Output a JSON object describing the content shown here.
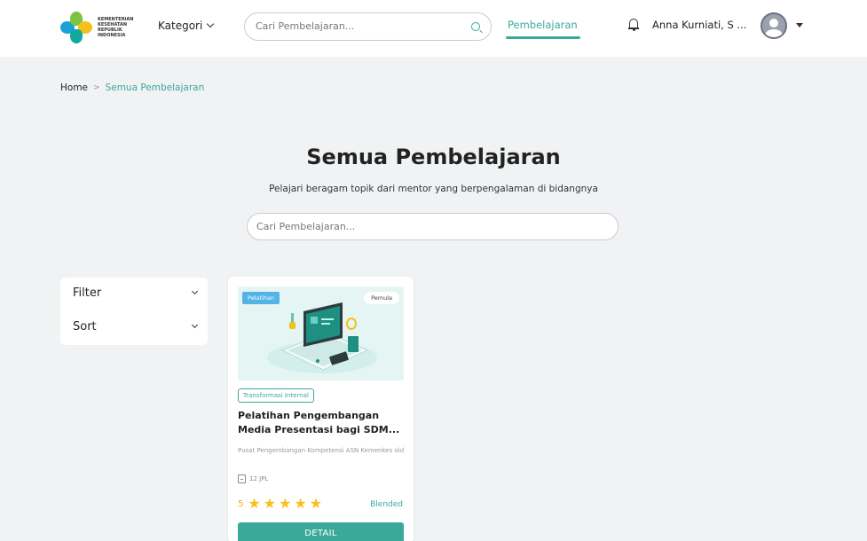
{
  "header": {
    "logo_text": "KEMENTERIAN KESEHATAN REPUBLIK INDONESIA",
    "kategori_label": "Kategori",
    "search_placeholder": "Cari Pembelajaran...",
    "nav_active": "Pembelajaran",
    "user_name": "Anna Kurniati, S ...",
    "colors": {
      "accent": "#3aa99a",
      "logo_blue": "#1aa0d8",
      "logo_green": "#7ec242",
      "logo_yellow": "#f2c21a",
      "logo_teal": "#13a89e"
    }
  },
  "breadcrumb": {
    "home": "Home",
    "separator": ">",
    "current": "Semua Pembelajaran"
  },
  "hero": {
    "title": "Semua Pembelajaran",
    "subtitle": "Pelajari beragam topik dari mentor yang berpengalaman di bidangnya",
    "search_placeholder": "Cari Pembelajaran..."
  },
  "filters": [
    {
      "label": "Filter"
    },
    {
      "label": "Sort"
    }
  ],
  "card": {
    "badge_type": "Pelatihan",
    "badge_level": "Pemula",
    "tag": "Transformasi Internal",
    "title": "Pelatihan Pengembangan Media Presentasi bagi SDM...",
    "organizer": "Pusat Pengembangan Kompetensi ASN Kemenkes old",
    "jpl": "12 JPL",
    "rating_value": "5",
    "stars": 5,
    "mode": "Blended",
    "detail_label": "DETAIL"
  }
}
